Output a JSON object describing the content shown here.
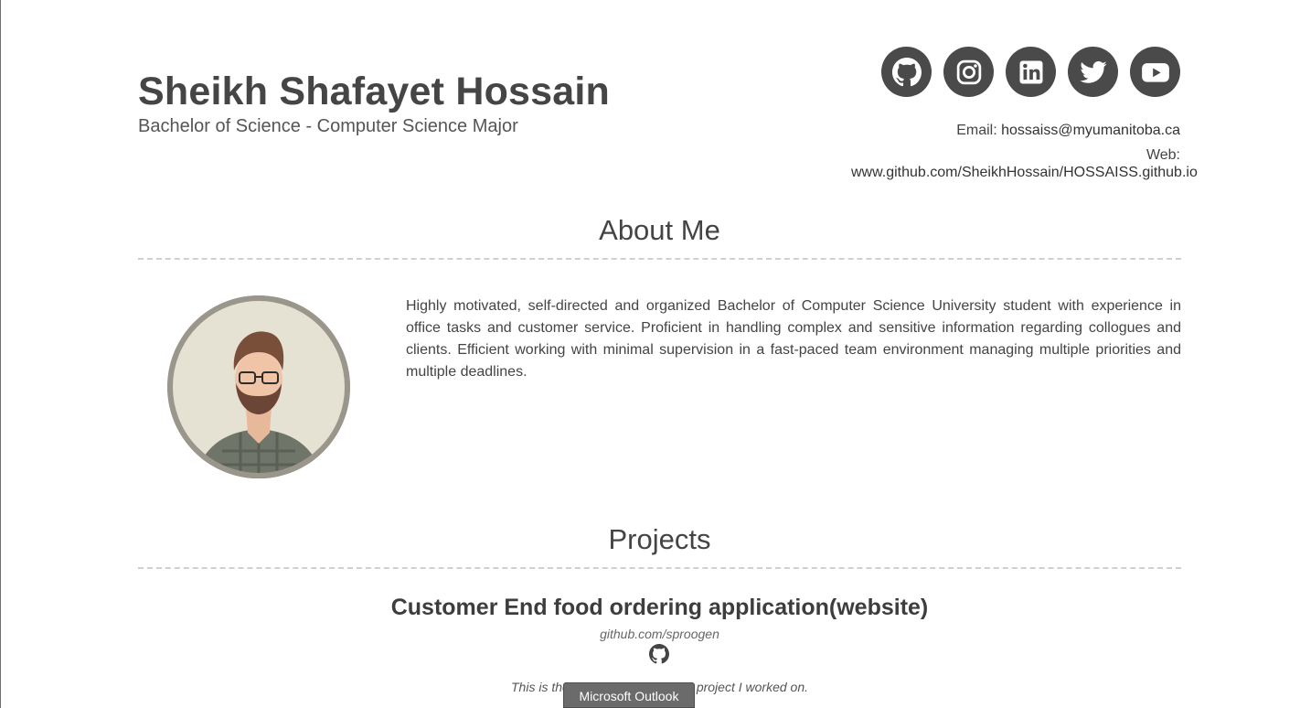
{
  "header": {
    "name": "Sheikh Shafayet Hossain",
    "subtitle": "Bachelor of Science - Computer Science Major"
  },
  "socials": [
    {
      "icon": "github-icon"
    },
    {
      "icon": "instagram-icon"
    },
    {
      "icon": "linkedin-icon"
    },
    {
      "icon": "twitter-icon"
    },
    {
      "icon": "youtube-icon"
    }
  ],
  "contact": {
    "email_label": "Email:",
    "email_value": "hossaiss@myumanitoba.ca",
    "web_label": "Web:",
    "web_value": "www.github.com/SheikhHossain/HOSSAISS.github.io"
  },
  "about": {
    "title": "About Me",
    "text": "Highly motivated, self-directed and organized Bachelor of Computer Science University student with experience in office tasks and customer service. Proficient in handling complex and sensitive information regarding collogues and clients. Efficient working with minimal supervision in a fast-paced team environment managing multiple priorities and multiple deadlines."
  },
  "projects": {
    "title": "Projects",
    "items": [
      {
        "name": "Customer End food ordering application(website)",
        "link": "github.com/sproogen",
        "desc_start": "This is the",
        "desc_end": "S project I worked on."
      }
    ]
  },
  "tooltip": {
    "label": "Microsoft Outlook"
  },
  "colors": {
    "icon_bg": "#4a4a4a",
    "divider": "#d0d0d0",
    "text": "#444444"
  }
}
